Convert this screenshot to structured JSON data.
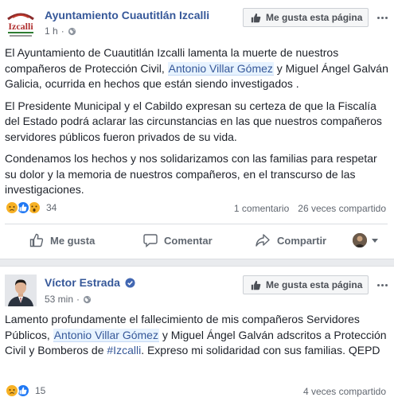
{
  "post1": {
    "page_name": "Ayuntamiento Cuautitlán Izcalli",
    "avatar_text": "Izcalli",
    "time": "1 h",
    "like_page_label": "Me gusta esta página",
    "paragraph1": {
      "pre": "El Ayuntamiento de Cuautitlán Izcalli lamenta la muerte de nuestros compañeros de Protección Civil, ",
      "tag": "Antonio Villar Gómez",
      "post": " y Miguel Ángel Galván Galicia, ocurrida en hechos que están siendo investigados ."
    },
    "paragraph2": "El Presidente Municipal y el Cabildo expresan su certeza de que la Fiscalía del Estado podrá aclarar las circunstancias en las que nuestros compañeros servidores públicos fueron privados de su vida.",
    "paragraph3": "Condenamos los hechos y nos solidarizamos con las familias para respetar su dolor y la memoria de nuestros compañeros, en el transcurso de las investigaciones.",
    "reactions_count": "34",
    "comments": "1 comentario",
    "shares": "26 veces compartido",
    "actions": {
      "like": "Me gusta",
      "comment": "Comentar",
      "share": "Compartir"
    }
  },
  "post2": {
    "page_name": "Víctor Estrada",
    "time": "53 min",
    "like_page_label": "Me gusta esta página",
    "pre": "Lamento profundamente el fallecimiento de mis compañeros Servidores Públicos, ",
    "tag": "Antonio Villar Gómez",
    "mid": " y Miguel Ángel Galván adscritos a Protección Civil y Bomberos de ",
    "hashtag": "#Izcalli",
    "post": ". Expreso mi solidaridad con sus familias. QEPD",
    "reactions_count": "15",
    "shares": "4 veces compartido"
  },
  "colors": {
    "link": "#365899",
    "verified": "#4267b2",
    "sad": "#f7b125",
    "like": "#2078f4",
    "wow": "#f7b125"
  },
  "icons": [
    "globe-icon",
    "thumbs-up-icon",
    "more-icon",
    "sad-reaction-icon",
    "like-reaction-icon",
    "wow-reaction-icon",
    "comment-icon",
    "share-icon",
    "verified-icon",
    "caret-down-icon"
  ]
}
